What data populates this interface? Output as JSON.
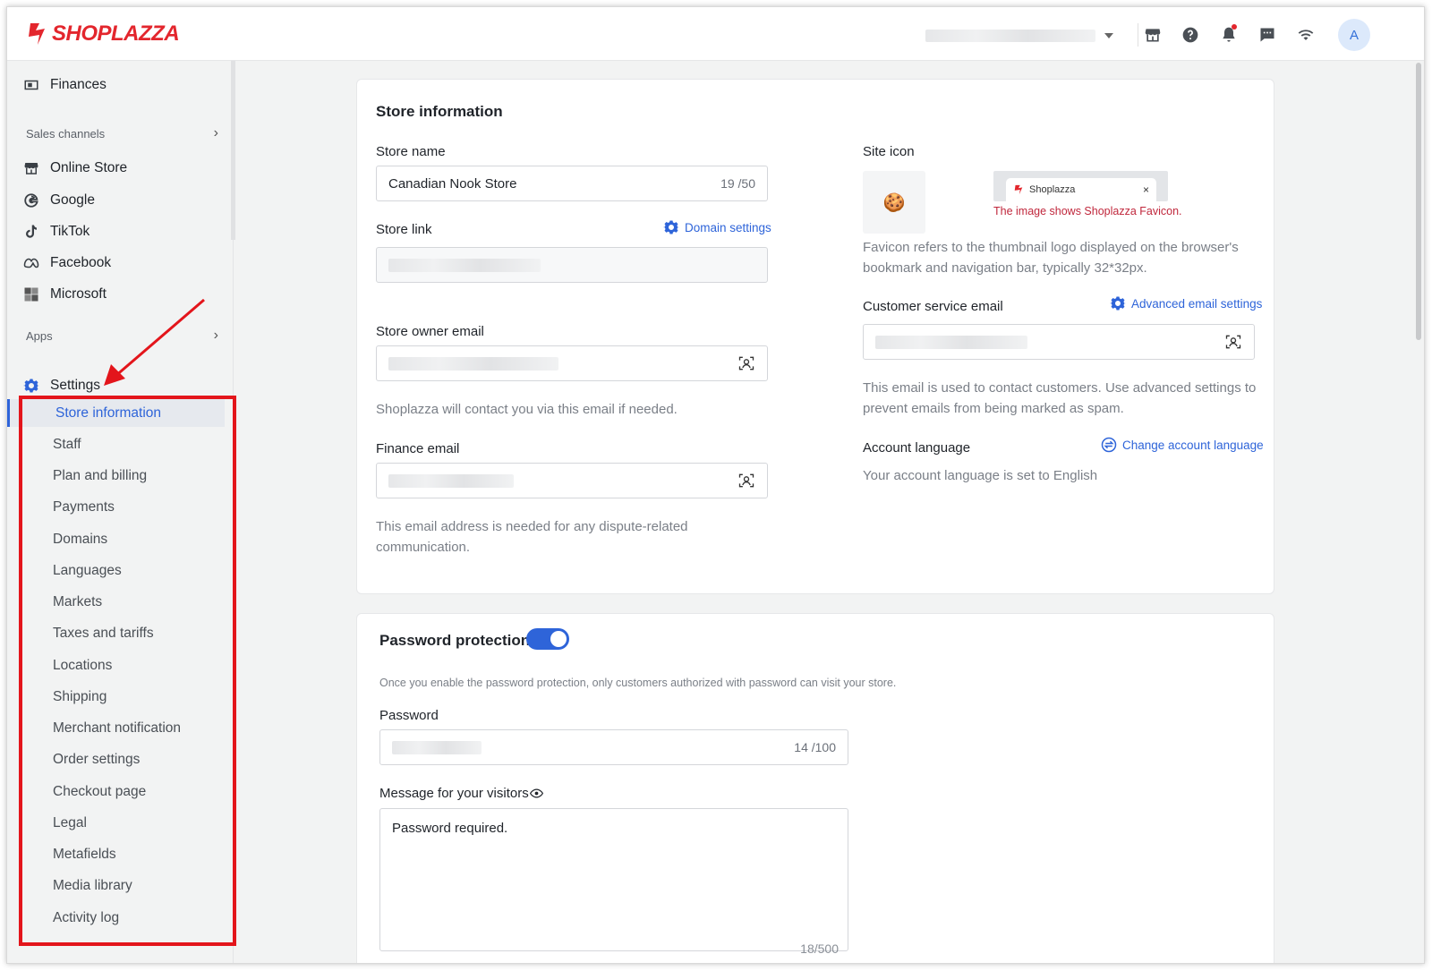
{
  "app": {
    "brand": "SHOPLAZZA",
    "avatar_initial": "A"
  },
  "topbar": {
    "icons": [
      "storefront-icon",
      "help-icon",
      "bell-icon",
      "chat-icon",
      "wifi-icon"
    ]
  },
  "sidebar": {
    "finances": "Finances",
    "sales_channels_label": "Sales channels",
    "channels": [
      "Online Store",
      "Google",
      "TikTok",
      "Facebook",
      "Microsoft"
    ],
    "apps_label": "Apps",
    "settings_label": "Settings",
    "settings_items": [
      "Store information",
      "Staff",
      "Plan and billing",
      "Payments",
      "Domains",
      "Languages",
      "Markets",
      "Taxes and tariffs",
      "Locations",
      "Shipping",
      "Merchant notification",
      "Order settings",
      "Checkout page",
      "Legal",
      "Metafields",
      "Media library",
      "Activity log"
    ],
    "active_item": "Store information"
  },
  "store_info": {
    "title": "Store information",
    "store_name_label": "Store name",
    "store_name_value": "Canadian Nook Store",
    "store_name_counter": "19 /50",
    "store_link_label": "Store link",
    "domain_settings": "Domain settings",
    "owner_email_label": "Store owner email",
    "owner_email_help": "Shoplazza will contact you via this email if needed.",
    "finance_email_label": "Finance email",
    "finance_email_help": "This email address is needed for any dispute-related communication.",
    "site_icon_label": "Site icon",
    "site_icon_glyph": "🍪",
    "favicon_tab_name": "Shoplazza",
    "favicon_tab_close": "×",
    "favicon_caption": "The image shows Shoplazza Favicon.",
    "favicon_help": "Favicon refers to the thumbnail logo displayed on the browser's bookmark and navigation bar, typically 32*32px.",
    "cs_email_label": "Customer service email",
    "advanced_email": "Advanced email settings",
    "cs_email_help": "This email is used to contact customers. Use advanced settings to prevent emails from being marked as spam.",
    "account_language_label": "Account language",
    "change_language": "Change account language",
    "account_language_help": "Your account language is set to English"
  },
  "password": {
    "title": "Password protection",
    "enabled": true,
    "description": "Once you enable the password protection, only customers authorized with password can visit your store.",
    "password_label": "Password",
    "password_counter": "14 /100",
    "message_label": "Message for your visitors",
    "message_value": "Password required.",
    "message_counter": "18/500"
  },
  "colors": {
    "accent": "#2e64d9",
    "brand_red": "#e3262d",
    "highlight": "#e3151b"
  }
}
